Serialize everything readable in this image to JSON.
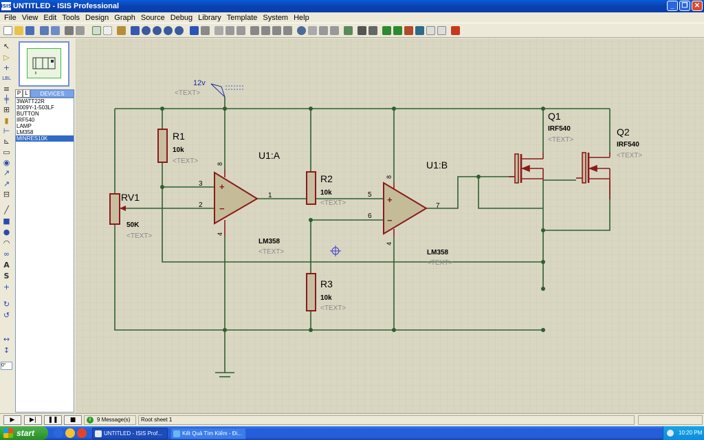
{
  "window": {
    "title": "UNTITLED - ISIS Professional",
    "icon_text": "ISIS"
  },
  "menu": [
    "File",
    "View",
    "Edit",
    "Tools",
    "Design",
    "Graph",
    "Source",
    "Debug",
    "Library",
    "Template",
    "System",
    "Help"
  ],
  "device_panel": {
    "tab_p": "P",
    "tab_l": "L",
    "tab_devices": "DEVICES",
    "devices": [
      "3WATT22R",
      "3009Y-1-503LF",
      "BUTTON",
      "IRF540",
      "LAMP",
      "LM358",
      "MINRES10K"
    ],
    "selected": "MINRES10K"
  },
  "rotation": "0°",
  "schematic": {
    "power_label": "12v",
    "text_placeholder": "<TEXT>",
    "components": {
      "rv1": {
        "ref": "RV1",
        "value": "50K"
      },
      "r1": {
        "ref": "R1",
        "value": "10k"
      },
      "r2": {
        "ref": "R2",
        "value": "10k"
      },
      "r3": {
        "ref": "R3",
        "value": "10k"
      },
      "u1a": {
        "ref": "U1:A",
        "value": "LM358"
      },
      "u1b": {
        "ref": "U1:B",
        "value": "LM358"
      },
      "q1": {
        "ref": "Q1",
        "value": "IRF540"
      },
      "q2": {
        "ref": "Q2",
        "value": "IRF540"
      }
    },
    "pins": {
      "u1a_in_plus": "3",
      "u1a_in_minus": "2",
      "u1a_out": "1",
      "u1a_vcc": "8",
      "u1a_gnd": "4",
      "u1b_in_plus": "5",
      "u1b_in_minus": "6",
      "u1b_out": "7",
      "u1b_vcc": "8",
      "u1b_gnd": "4",
      "plus_sign": "+",
      "minus_sign": "−"
    }
  },
  "statusbar": {
    "messages": "9 Message(s)",
    "info_icon": "i",
    "sheet": "Root sheet 1"
  },
  "taskbar": {
    "start": "start",
    "tasks": [
      "UNTITLED - ISIS Prof...",
      "Kết Quả Tìm Kiếm - Đi..."
    ],
    "clock": "10:20 PM"
  },
  "colors": {
    "wire": "#2e5e2e",
    "component": "#8b1a1a",
    "component_fill": "#c8bfa0",
    "opamp_fill": "#c4bc98",
    "text_gray": "#8a8a8a",
    "canvas_bg": "#d9d7c2",
    "grid": "#c5c3ac"
  }
}
